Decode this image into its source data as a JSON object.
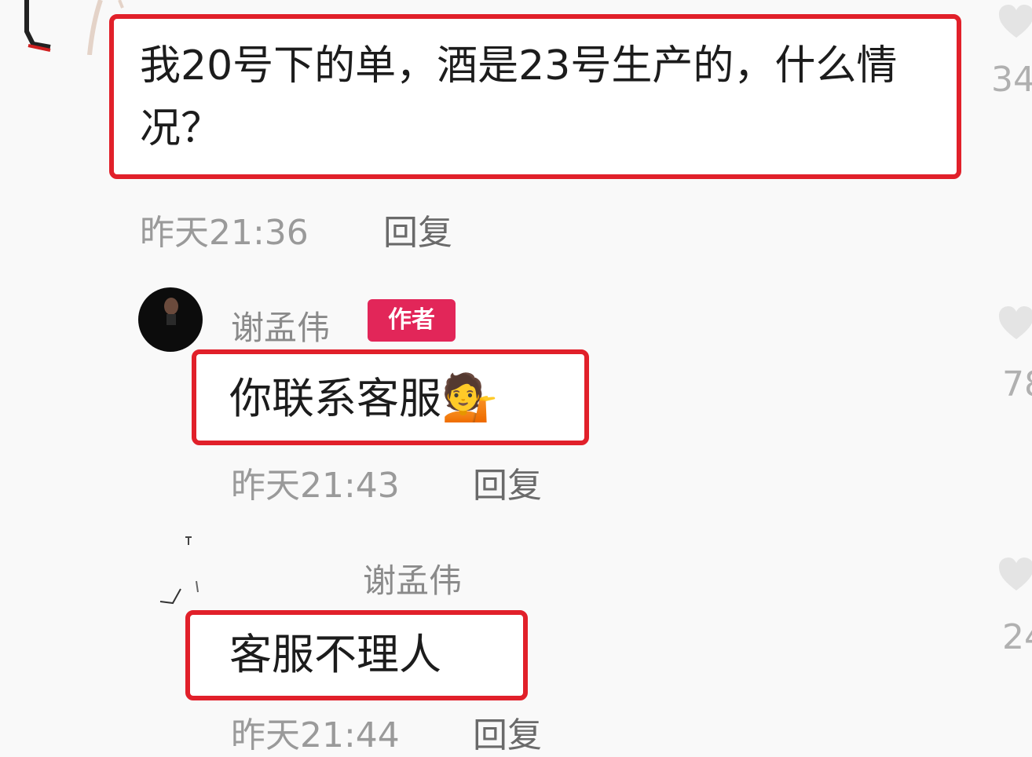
{
  "comments": [
    {
      "text": "我20号下的单，酒是23号生产的，什么情况？",
      "time": "昨天21:36",
      "reply_label": "回复",
      "likes": "34"
    },
    {
      "author": "谢孟伟",
      "badge": "作者",
      "text": "你联系客服",
      "emoji": "💁",
      "time": "昨天21:43",
      "reply_label": "回复",
      "likes": "78"
    },
    {
      "author": "谢孟伟",
      "text": "客服不理人",
      "time": "昨天21:44",
      "reply_label": "回复",
      "likes": "24"
    }
  ],
  "colors": {
    "highlight_border": "#e1202a",
    "author_badge": "#e22659"
  },
  "icons": [
    "heart-icon",
    "avatar"
  ]
}
